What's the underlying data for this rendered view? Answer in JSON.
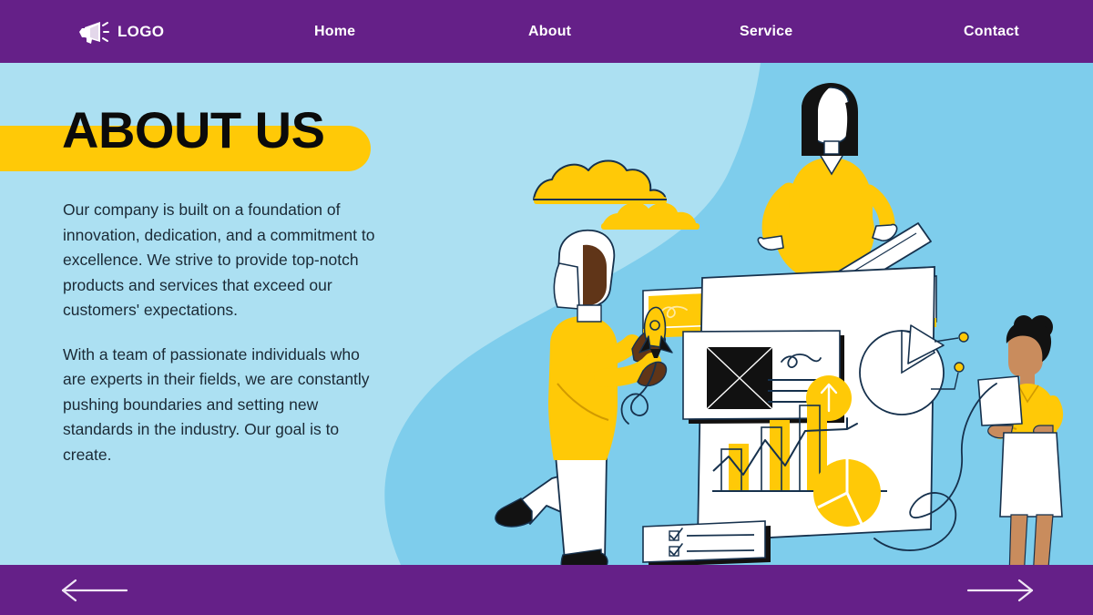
{
  "theme": {
    "purple": "#652088",
    "yellow": "#ffc907",
    "light_blue": "#ace0f2",
    "mid_blue": "#7ecdec",
    "ink": "#1b2a36",
    "white": "#ffffff",
    "black": "#111111"
  },
  "navbar": {
    "logo_icon": "megaphone-icon",
    "logo_text": "LOGO",
    "links": [
      {
        "label": "Home"
      },
      {
        "label": "About"
      },
      {
        "label": "Service"
      },
      {
        "label": "Contact"
      }
    ]
  },
  "hero": {
    "title": "ABOUT US",
    "paragraphs": [
      "Our company is built on a foundation of innovation, dedication, and a commitment to excellence. We strive to provide top-notch products and services that exceed our customers' expectations.",
      "With a team of passionate individuals who are experts in their fields, we are constantly pushing boundaries and setting new standards in the industry. Our goal is to create."
    ]
  },
  "illustration": {
    "alt": "team analyzing data dashboard illustration",
    "elements": [
      "cloud-large",
      "cloud-small",
      "search-bar-card",
      "magnifier-icon",
      "ruler",
      "woman-with-ruler",
      "man-with-rocket",
      "rocket-icon",
      "document-card",
      "image-placeholder",
      "arrow-up-badge",
      "bar-chart",
      "trend-line-arrow",
      "pie-chart-white",
      "pie-chart-yellow",
      "checklist-card",
      "woman-with-paper",
      "swirl-line"
    ]
  },
  "footer": {
    "prev_label": "Previous slide",
    "next_label": "Next slide",
    "prev_icon": "arrow-left-icon",
    "next_icon": "arrow-right-icon"
  }
}
